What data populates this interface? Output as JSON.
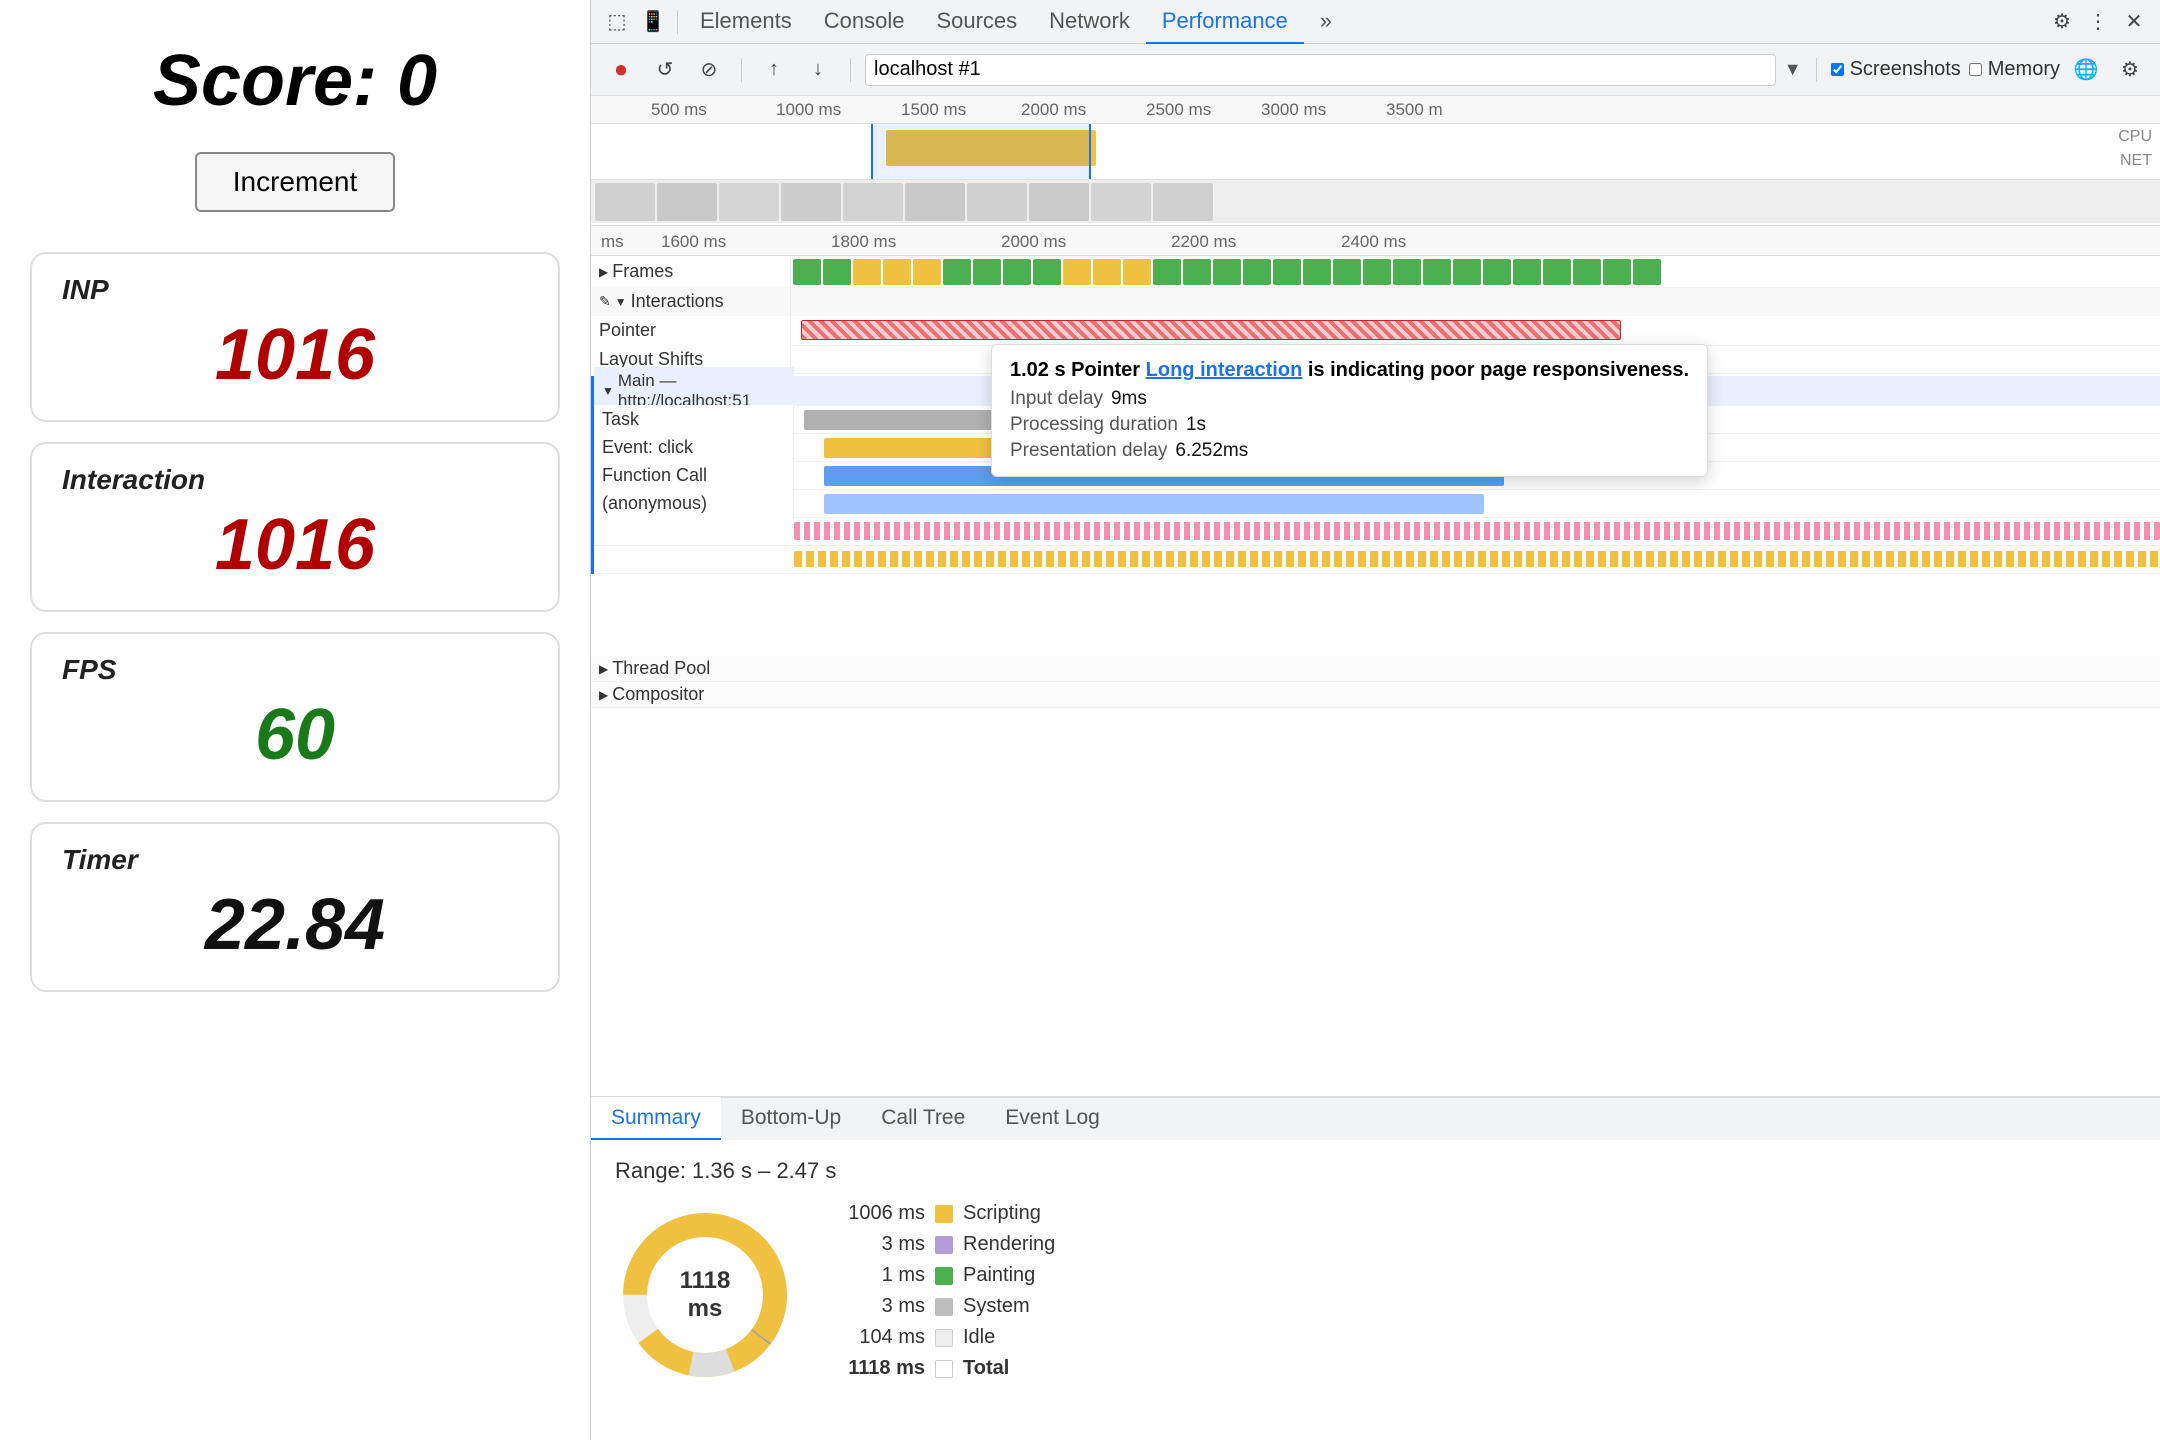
{
  "app": {
    "score_title": "Score: 0",
    "increment_label": "Increment"
  },
  "metrics": [
    {
      "id": "inp",
      "label": "INP",
      "value": "1016",
      "color": "red"
    },
    {
      "id": "interaction",
      "label": "Interaction",
      "value": "1016",
      "color": "red"
    },
    {
      "id": "fps",
      "label": "FPS",
      "value": "60",
      "color": "green"
    },
    {
      "id": "timer",
      "label": "Timer",
      "value": "22.84",
      "color": "dark"
    }
  ],
  "devtools": {
    "tabs": [
      "Elements",
      "Console",
      "Sources",
      "Network",
      "Performance"
    ],
    "active_tab": "Performance",
    "record_url": "localhost #1",
    "screenshots_checked": true,
    "memory_checked": false
  },
  "timeline": {
    "ruler_labels": [
      "500 ms",
      "1000 ms",
      "1500 ms",
      "2000 ms",
      "2500 ms",
      "3000 ms",
      "3500 m"
    ],
    "detail_ruler": [
      "1600 ms",
      "1800 ms",
      "2000 ms",
      "2200 ms",
      "2400 ms"
    ],
    "cpu_label": "CPU",
    "net_label": "NET",
    "sections": {
      "frames_label": "Frames",
      "interactions_label": "Interactions",
      "pointer_label": "Pointer",
      "layout_shifts_label": "Layout Shifts",
      "main_label": "Main — http://localhost:51",
      "task_label": "Task",
      "event_click_label": "Event: click",
      "function_call_label": "Function Call",
      "anonymous_label": "(anonymous)",
      "thread_pool_label": "Thread Pool",
      "compositor_label": "Compositor"
    }
  },
  "tooltip": {
    "duration": "1.02 s",
    "type": "Pointer",
    "link_text": "Long interaction",
    "suffix": "is indicating poor page responsiveness.",
    "input_delay_label": "Input delay",
    "input_delay_value": "9ms",
    "processing_label": "Processing duration",
    "processing_value": "1s",
    "presentation_label": "Presentation delay",
    "presentation_value": "6.252ms"
  },
  "bottom_tabs": [
    "Summary",
    "Bottom-Up",
    "Call Tree",
    "Event Log"
  ],
  "active_bottom_tab": "Summary",
  "summary": {
    "range": "Range: 1.36 s – 2.47 s",
    "donut_label": "1118 ms",
    "total_ms": "1118 ms",
    "legend": [
      {
        "ms": "1006 ms",
        "color": "#f0c040",
        "name": "Scripting"
      },
      {
        "ms": "3 ms",
        "color": "#b39ddb",
        "name": "Rendering"
      },
      {
        "ms": "1 ms",
        "color": "#4caf50",
        "name": "Painting"
      },
      {
        "ms": "3 ms",
        "color": "#bdbdbd",
        "name": "System"
      },
      {
        "ms": "104 ms",
        "color": "#eeeeee",
        "name": "Idle"
      },
      {
        "ms": "1118 ms",
        "color": "#fff",
        "name": "Total",
        "border": "#ccc"
      }
    ]
  },
  "icons": {
    "record": "⏺",
    "reload": "↺",
    "clear": "⊘",
    "upload": "↑",
    "download": "↓",
    "chevron_right": "▶",
    "chevron_down": "▼",
    "triangle_right": "▶",
    "pencil": "✎",
    "gear": "⚙",
    "close": "✕",
    "more": "⋮",
    "screenshot": "📷",
    "node_select": "⬚",
    "device": "📱",
    "search": "🔍"
  }
}
